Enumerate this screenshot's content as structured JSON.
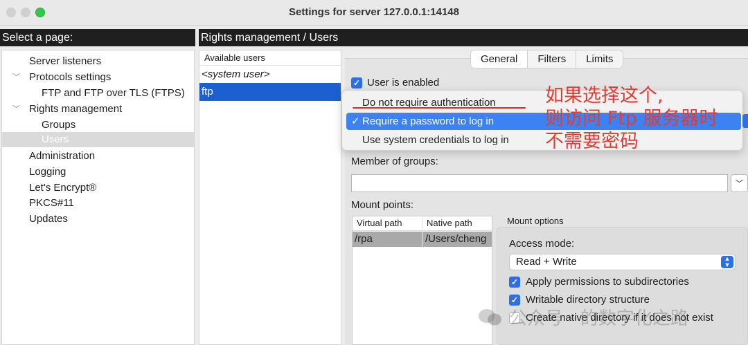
{
  "window": {
    "title": "Settings for server 127.0.0.1:14148"
  },
  "left_panel": {
    "header": "Select a page:",
    "items": [
      {
        "label": "Server listeners"
      },
      {
        "label": "Protocols settings"
      },
      {
        "label": "FTP and FTP over TLS (FTPS)"
      },
      {
        "label": "Rights management"
      },
      {
        "label": "Groups"
      },
      {
        "label": "Users"
      },
      {
        "label": "Administration"
      },
      {
        "label": "Logging"
      },
      {
        "label": "Let's Encrypt®"
      },
      {
        "label": "PKCS#11"
      },
      {
        "label": "Updates"
      }
    ]
  },
  "right_panel": {
    "header": "Rights management / Users",
    "users": {
      "header": "Available users",
      "items": [
        "<system user>",
        "ftp"
      ],
      "selected": "ftp"
    },
    "tabs": [
      "General",
      "Filters",
      "Limits"
    ],
    "active_tab": "General",
    "user_enabled_label": "User is enabled",
    "auth_menu": {
      "items": [
        "Do not require authentication",
        "Require a password to log in",
        "Use system credentials to log in"
      ],
      "selected": "Require a password to log in",
      "check_glyph": "✓"
    },
    "groups_label": "Member of groups:",
    "mount_points_label": "Mount points:",
    "mount_table": {
      "columns": [
        "Virtual path",
        "Native path"
      ],
      "rows": [
        {
          "virtual": "/rpa",
          "native": "/Users/cheng"
        }
      ]
    },
    "mount_options": {
      "title": "Mount options",
      "access_mode_label": "Access mode:",
      "access_mode_value": "Read + Write",
      "checkboxes": [
        {
          "label": "Apply permissions to subdirectories",
          "checked": true
        },
        {
          "label": "Writable directory structure",
          "checked": true
        },
        {
          "label": "Create native directory if it does not exist",
          "checked": false
        }
      ]
    }
  },
  "annotation": {
    "lines": [
      "如果选择这个,",
      "则访问 Ftp 服务器时",
      "不需要密码"
    ],
    "color": "#e23b32"
  },
  "watermark": {
    "text": "公众号 · 的数字化之路"
  },
  "colors": {
    "selection_blue": "#1b5fd0",
    "menu_highlight": "#3c82f2",
    "checkbox": "#2d6fe6",
    "annotation_red": "#e23b32"
  }
}
